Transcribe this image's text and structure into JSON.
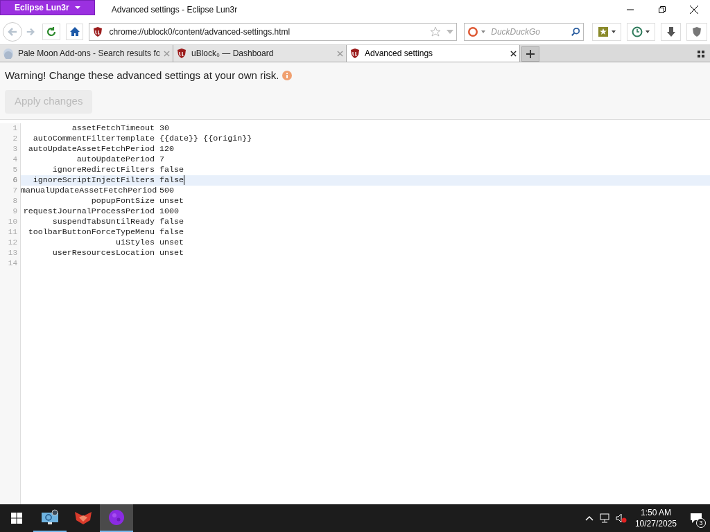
{
  "window": {
    "title": "Advanced settings - Eclipse Lun3r",
    "app_button": "Eclipse Lun3r"
  },
  "navbar": {
    "url": "chrome://ublock0/content/advanced-settings.html",
    "search_placeholder": "DuckDuckGo"
  },
  "tabs": [
    {
      "label": "Pale Moon Add-ons - Search results fo",
      "selected": false,
      "kind": "moon"
    },
    {
      "label": "uBlock₀ — Dashboard",
      "selected": false,
      "kind": "shield"
    },
    {
      "label": "Advanced settings",
      "selected": true,
      "kind": "shield"
    }
  ],
  "page": {
    "warning": "Warning! Change these advanced settings at your own risk.",
    "apply_button": {
      "label": "Apply changes",
      "disabled": true
    }
  },
  "editor": {
    "lines": [
      {
        "number": "1",
        "key": "assetFetchTimeout",
        "value": "30",
        "active": false
      },
      {
        "number": "2",
        "key": "autoCommentFilterTemplate",
        "value": "{{date}} {{origin}}",
        "active": false
      },
      {
        "number": "3",
        "key": "autoUpdateAssetFetchPeriod",
        "value": "120",
        "active": false
      },
      {
        "number": "4",
        "key": "autoUpdatePeriod",
        "value": "7",
        "active": false
      },
      {
        "number": "5",
        "key": "ignoreRedirectFilters",
        "value": "false",
        "active": false
      },
      {
        "number": "6",
        "key": "ignoreScriptInjectFilters",
        "value": "false",
        "active": true
      },
      {
        "number": "7",
        "key": "manualUpdateAssetFetchPeriod",
        "value": "500",
        "active": false
      },
      {
        "number": "8",
        "key": "popupFontSize",
        "value": "unset",
        "active": false
      },
      {
        "number": "9",
        "key": "requestJournalProcessPeriod",
        "value": "1000",
        "active": false
      },
      {
        "number": "10",
        "key": "suspendTabsUntilReady",
        "value": "false",
        "active": false
      },
      {
        "number": "11",
        "key": "toolbarButtonForceTypeMenu",
        "value": "false",
        "active": false
      },
      {
        "number": "12",
        "key": "uiStyles",
        "value": "unset",
        "active": false
      },
      {
        "number": "13",
        "key": "userResourcesLocation",
        "value": "unset",
        "active": false
      },
      {
        "number": "14",
        "active": false
      }
    ]
  },
  "taskbar": {
    "apps": [
      {
        "kind": "network",
        "selected": false,
        "running": true
      },
      {
        "kind": "fox",
        "selected": false,
        "running": false
      },
      {
        "kind": "moon",
        "selected": true,
        "running": true
      }
    ],
    "time": "1:50 AM",
    "date": "10/27/2025",
    "notifications": "3"
  }
}
